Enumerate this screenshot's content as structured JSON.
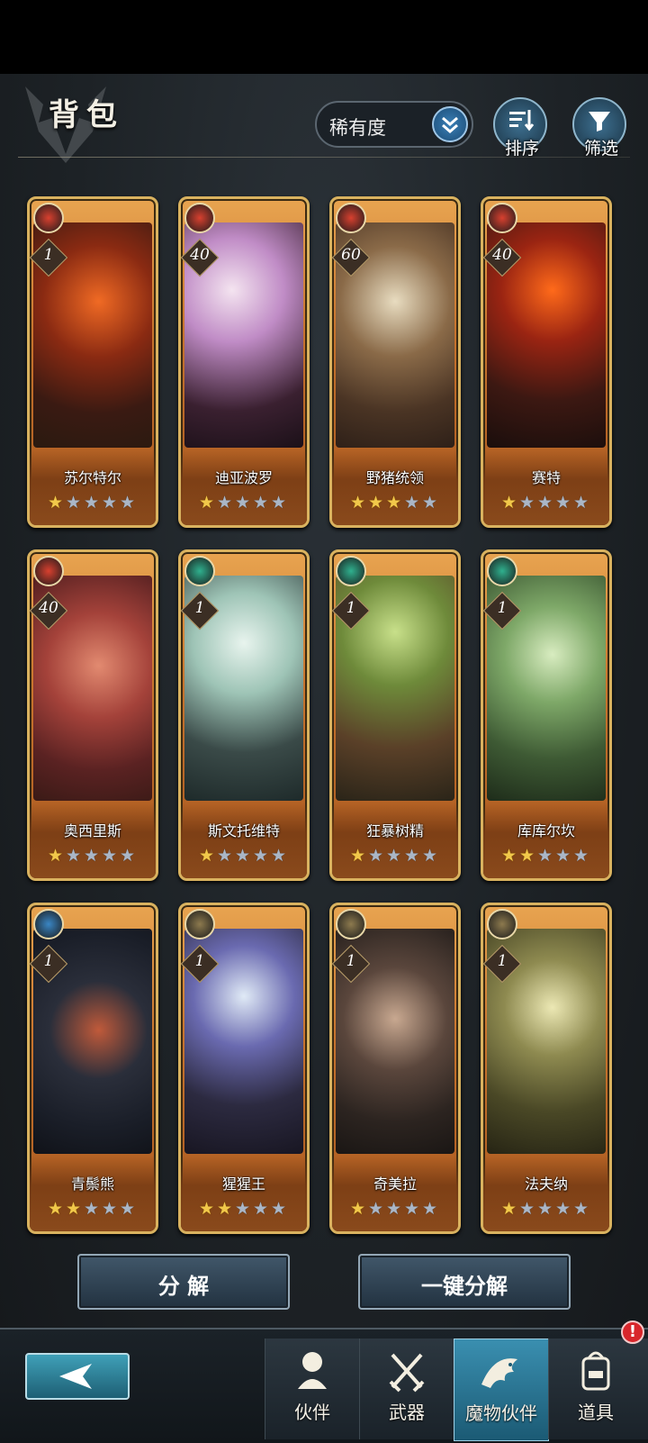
{
  "header": {
    "title": "背包",
    "sort_select": "稀有度",
    "sort_button": "排序",
    "filter_button": "筛选"
  },
  "colors": {
    "fire": "#d8402f",
    "wind": "#2fb08e",
    "water": "#3a86c4",
    "earth": "#8d7a4e",
    "card_gold": "#d9b25f"
  },
  "cards": [
    {
      "name": "苏尔特尔",
      "level": "1",
      "element": "fire-icon",
      "stars": 1,
      "max_stars": 5
    },
    {
      "name": "迪亚波罗",
      "level": "40",
      "element": "fire-icon",
      "stars": 1,
      "max_stars": 5
    },
    {
      "name": "野猪统领",
      "level": "60",
      "element": "fire-icon",
      "stars": 3,
      "max_stars": 5
    },
    {
      "name": "赛特",
      "level": "40",
      "element": "fire-icon",
      "stars": 1,
      "max_stars": 5
    },
    {
      "name": "奥西里斯",
      "level": "40",
      "element": "fire-icon",
      "stars": 1,
      "max_stars": 5
    },
    {
      "name": "斯文托维特",
      "level": "1",
      "element": "wind-icon",
      "stars": 1,
      "max_stars": 5
    },
    {
      "name": "狂暴树精",
      "level": "1",
      "element": "wind-icon",
      "stars": 1,
      "max_stars": 5
    },
    {
      "name": "库库尔坎",
      "level": "1",
      "element": "wind-icon",
      "stars": 2,
      "max_stars": 5
    },
    {
      "name": "青鬃熊",
      "level": "1",
      "element": "water-icon",
      "stars": 2,
      "max_stars": 5
    },
    {
      "name": "猩猩王",
      "level": "1",
      "element": "earth-icon",
      "stars": 2,
      "max_stars": 5
    },
    {
      "name": "奇美拉",
      "level": "1",
      "element": "earth-icon",
      "stars": 1,
      "max_stars": 5
    },
    {
      "name": "法夫纳",
      "level": "1",
      "element": "earth-icon",
      "stars": 1,
      "max_stars": 5
    }
  ],
  "actions": {
    "decompose": "分 解",
    "one_key_decompose": "一键分解"
  },
  "footer": {
    "tabs": [
      {
        "label": "伙伴",
        "icon": "partner-icon",
        "active": false
      },
      {
        "label": "武器",
        "icon": "crossed-swords-icon",
        "active": false
      },
      {
        "label": "魔物伙伴",
        "icon": "dragon-icon",
        "active": true
      },
      {
        "label": "道具",
        "icon": "backpack-icon",
        "active": false
      }
    ],
    "badge": "!"
  }
}
